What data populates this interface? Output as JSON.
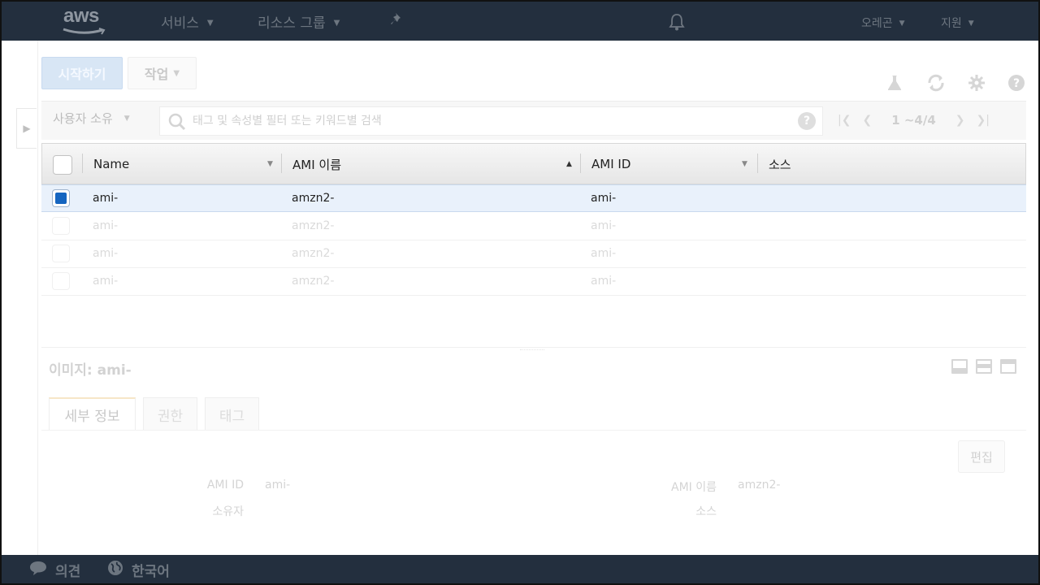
{
  "nav": {
    "logo_text": "aws",
    "services": "서비스",
    "resource_groups": "리소스 그룹",
    "region": "오레곤",
    "support": "지원"
  },
  "toolbar": {
    "launch": "시작하기",
    "actions": "작업"
  },
  "filter": {
    "owner": "사용자 소유",
    "search_placeholder": "태그 및 속성별 필터 또는 키워드별 검색",
    "help": "?",
    "pagination": "1 ~4/4"
  },
  "table": {
    "columns": [
      "Name",
      "AMI 이름",
      "AMI ID",
      "소스"
    ],
    "rows": [
      {
        "name": "ami-",
        "ami_name": "amzn2-",
        "ami_id": "ami-"
      },
      {
        "name": "ami-",
        "ami_name": "amzn2-",
        "ami_id": "ami-"
      },
      {
        "name": "ami-",
        "ami_name": "amzn2-",
        "ami_id": "ami-"
      },
      {
        "name": "ami-",
        "ami_name": "amzn2-",
        "ami_id": "ami-"
      }
    ],
    "selected_row": 0
  },
  "details": {
    "title": "이미지: ami-",
    "tabs": [
      "세부 정보",
      "권한",
      "태그"
    ],
    "edit": "편집",
    "fields": {
      "ami_id_label": "AMI ID",
      "ami_id_value": "ami-",
      "owner_label": "소유자",
      "ami_name_label": "AMI 이름",
      "ami_name_value": "amzn2-",
      "source_label": "소스"
    }
  },
  "footer": {
    "feedback": "의견",
    "language": "한국어"
  },
  "icons": [
    "aws-logo",
    "chevron-down-icon",
    "pin-icon",
    "bell-icon",
    "flask-icon",
    "refresh-icon",
    "gear-icon",
    "help-icon",
    "search-icon",
    "first-page-icon",
    "prev-page-icon",
    "next-page-icon",
    "last-page-icon",
    "speech-bubble-icon",
    "globe-icon"
  ],
  "colors": {
    "nav_bg": "#232f3e",
    "primary_button": "#d8e6f5",
    "selected_row": "#e9f1fb",
    "checkbox_checked": "#1565c0"
  }
}
